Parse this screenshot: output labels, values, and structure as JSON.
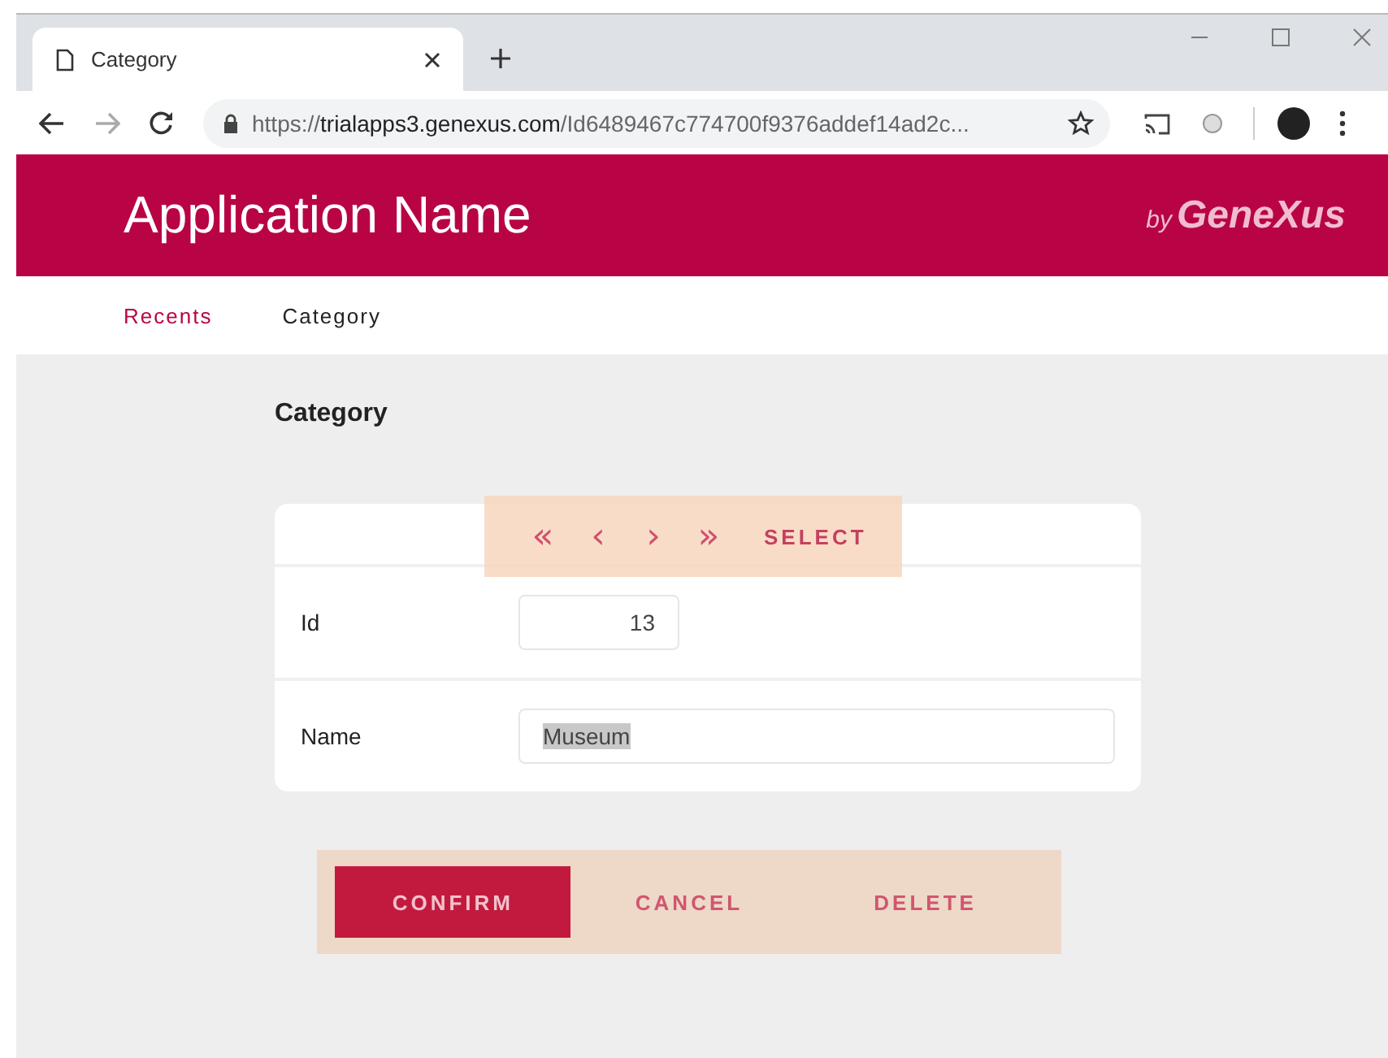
{
  "browser": {
    "tab_title": "Category",
    "url_scheme": "https://",
    "url_host": "trialapps3.genexus.com",
    "url_path": "/Id6489467c774700f9376addef14ad2c..."
  },
  "header": {
    "app_name": "Application Name",
    "brand_by": "by",
    "brand_name": "GeneXus"
  },
  "nav": [
    {
      "label": "Recents",
      "selected": false
    },
    {
      "label": "Category",
      "selected": true
    }
  ],
  "page_title": "Category",
  "navigator": {
    "highlighted": true,
    "controls": [
      "«",
      "‹",
      "›",
      "»"
    ],
    "select_label": "SELECT"
  },
  "fields": [
    {
      "label": "Id",
      "value": "13",
      "kind": "number",
      "text_selected": false
    },
    {
      "label": "Name",
      "value": "Museum",
      "kind": "text",
      "text_selected": true
    }
  ],
  "actions": {
    "highlighted": true,
    "buttons": [
      {
        "label": "CONFIRM",
        "kind": "primary"
      },
      {
        "label": "CANCEL",
        "kind": "link"
      },
      {
        "label": "DELETE",
        "kind": "link"
      }
    ]
  }
}
